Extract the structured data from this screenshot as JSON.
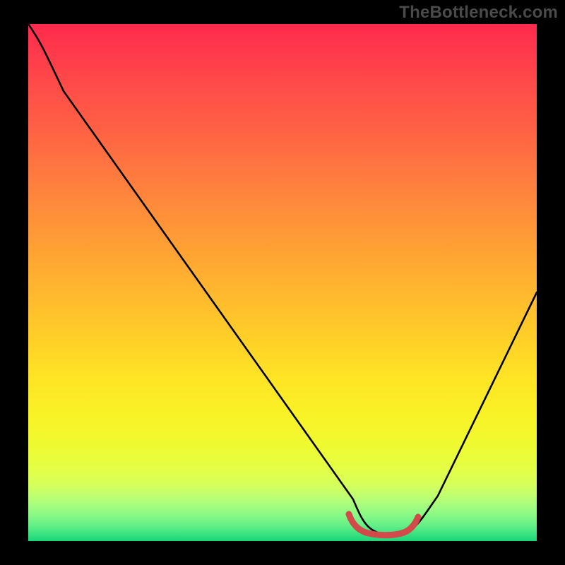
{
  "watermark": "TheBottleneck.com",
  "chart_data": {
    "type": "line",
    "title": "",
    "xlabel": "",
    "ylabel": "",
    "xlim": [
      0,
      100
    ],
    "ylim": [
      0,
      100
    ],
    "grid": false,
    "legend": false,
    "background": "vertical-rainbow-gradient-red-to-green",
    "series": [
      {
        "name": "bottleneck-curve",
        "color": "#000000",
        "x": [
          0,
          4,
          12,
          20,
          28,
          36,
          44,
          52,
          60,
          62,
          65,
          68,
          71,
          73,
          75,
          78,
          82,
          86,
          90,
          94,
          98,
          100
        ],
        "y": [
          100,
          96,
          84,
          72,
          60,
          48,
          36,
          24,
          10,
          6,
          3,
          2,
          1.5,
          1.5,
          2,
          4,
          9,
          17,
          26,
          35,
          44,
          49
        ]
      },
      {
        "name": "optimal-zone-marker",
        "color": "#d24a4a",
        "stroke_width": 7,
        "x": [
          62,
          64,
          66,
          68,
          70,
          72,
          74,
          75
        ],
        "y": [
          4.5,
          2,
          1.4,
          1.2,
          1.2,
          1.3,
          1.8,
          3.2
        ]
      }
    ],
    "annotations": []
  },
  "colors": {
    "watermark": "#4a4a4a",
    "curve": "#000000",
    "marker": "#d24a4a",
    "frame": "#000000"
  }
}
